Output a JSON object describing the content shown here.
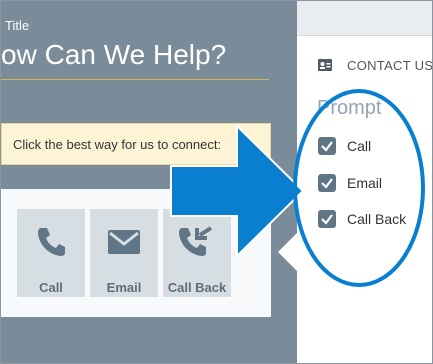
{
  "window": {
    "title_small": "Title",
    "heading": "ow Can We Help?"
  },
  "banner": {
    "text": "Click the best way for us to connect:"
  },
  "channels": [
    {
      "label": "Call",
      "icon": "phone-icon"
    },
    {
      "label": "Email",
      "icon": "envelope-icon"
    },
    {
      "label": "Call Back",
      "icon": "phone-callback-icon"
    }
  ],
  "side_panel": {
    "section_label": "CONTACT US",
    "section_icon": "contact-card-icon",
    "prompt_label": "Prompt",
    "options": [
      {
        "label": "Call",
        "checked": true
      },
      {
        "label": "Email",
        "checked": true
      },
      {
        "label": "Call Back",
        "checked": true
      }
    ]
  },
  "colors": {
    "background": "#7a8b99",
    "accent_blue": "#0a7fd0",
    "banner_bg": "#fdf4d6",
    "tile_bg": "#d6dde3",
    "checkbox": "#607585"
  }
}
